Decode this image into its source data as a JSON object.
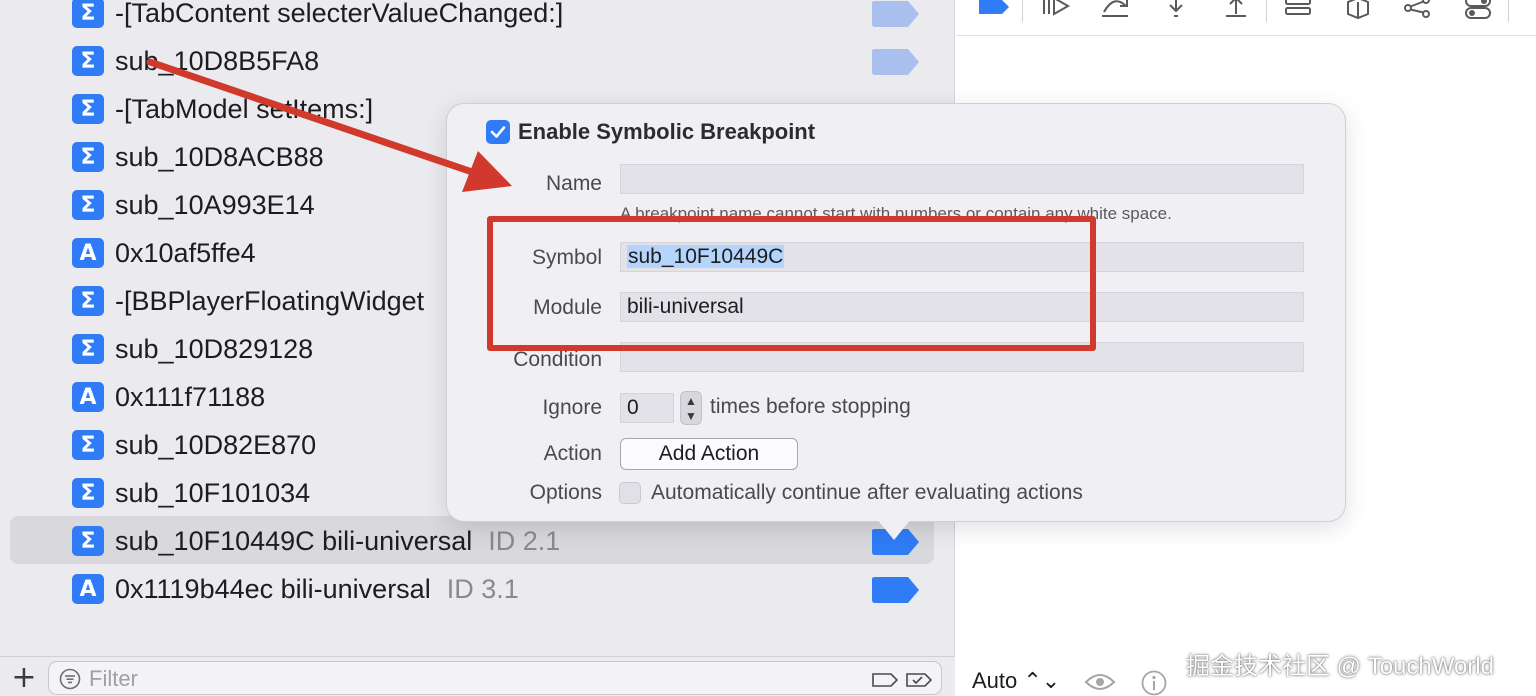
{
  "breakpoints": [
    {
      "type": "Σ",
      "name": "-[TabContent selecterValueChanged:]",
      "id": "",
      "marker": "light",
      "selected": false
    },
    {
      "type": "Σ",
      "name": "sub_10D8B5FA8",
      "id": "",
      "marker": "light",
      "selected": false
    },
    {
      "type": "Σ",
      "name": "-[TabModel setItems:]",
      "id": "",
      "marker": "none",
      "selected": false
    },
    {
      "type": "Σ",
      "name": "sub_10D8ACB88",
      "id": "",
      "marker": "none",
      "selected": false
    },
    {
      "type": "Σ",
      "name": "sub_10A993E14",
      "id": "",
      "marker": "none",
      "selected": false
    },
    {
      "type": "A",
      "name": "0x10af5ffe4",
      "id": "",
      "marker": "none",
      "selected": false
    },
    {
      "type": "Σ",
      "name": "-[BBPlayerFloatingWidget",
      "id": "",
      "marker": "none",
      "selected": false
    },
    {
      "type": "Σ",
      "name": "sub_10D829128",
      "id": "",
      "marker": "none",
      "selected": false
    },
    {
      "type": "A",
      "name": "0x111f71188",
      "id": "",
      "marker": "none",
      "selected": false
    },
    {
      "type": "Σ",
      "name": "sub_10D82E870",
      "id": "",
      "marker": "none",
      "selected": false
    },
    {
      "type": "Σ",
      "name": "sub_10F101034",
      "id": "",
      "marker": "none",
      "selected": false
    },
    {
      "type": "Σ",
      "name": "sub_10F10449C bili-universal",
      "id": "ID 2.1",
      "marker": "dark",
      "selected": true
    },
    {
      "type": "A",
      "name": "0x1119b44ec bili-universal",
      "id": "ID 3.1",
      "marker": "dark",
      "selected": false
    }
  ],
  "bottom_bar": {
    "add_label": "+",
    "filter_placeholder": "Filter"
  },
  "popover": {
    "enable_label": "Enable Symbolic Breakpoint",
    "enabled": true,
    "name_label": "Name",
    "name_value": "",
    "name_hint": "A breakpoint name cannot start with numbers or contain any white space.",
    "symbol_label": "Symbol",
    "symbol_value": "sub_10F10449C",
    "module_label": "Module",
    "module_value": "bili-universal",
    "condition_label": "Condition",
    "condition_value": "",
    "ignore_label": "Ignore",
    "ignore_value": "0",
    "ignore_suffix": "times before stopping",
    "action_label": "Action",
    "add_action_label": "Add Action",
    "options_label": "Options",
    "auto_continue_label": "Automatically continue after evaluating actions",
    "auto_continue": false
  },
  "right_pane": {
    "auto_label": "Auto ⌃⌄"
  },
  "watermark": "掘金技术社区 @ TouchWorld",
  "colors": {
    "accent": "#2f7cf6",
    "marker_light": "#a9c0ef",
    "annotation": "#d0392b"
  }
}
